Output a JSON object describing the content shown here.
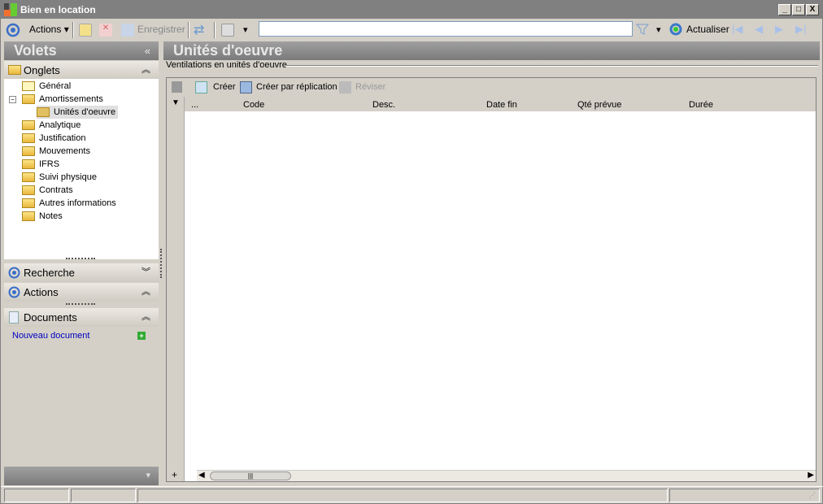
{
  "window": {
    "title": "Bien en location",
    "min": "_",
    "max": "□",
    "close": "X"
  },
  "toolbar": {
    "actions": "Actions",
    "save": "Enregistrer",
    "refresh": "Actualiser",
    "search_value": ""
  },
  "left": {
    "title": "Volets",
    "collapse": "«",
    "onglets": {
      "label": "Onglets",
      "items": [
        "Général",
        "Amortissements",
        "Unités d'oeuvre",
        "Analytique",
        "Justification",
        "Mouvements",
        "IFRS",
        "Suivi physique",
        "Contrats",
        "Autres informations",
        "Notes"
      ]
    },
    "recherche": "Recherche",
    "actions": "Actions",
    "documents": "Documents",
    "new_document": "Nouveau document"
  },
  "main": {
    "title": "Unités d'oeuvre",
    "group": "Ventilations en unités d'oeuvre",
    "grid_toolbar": {
      "create": "Créer",
      "replicate": "Créer par réplication",
      "revise": "Réviser"
    },
    "columns": [
      "...",
      "Code",
      "Desc.",
      "Date fin",
      "Qté prévue",
      "Durée"
    ],
    "add": "+"
  }
}
